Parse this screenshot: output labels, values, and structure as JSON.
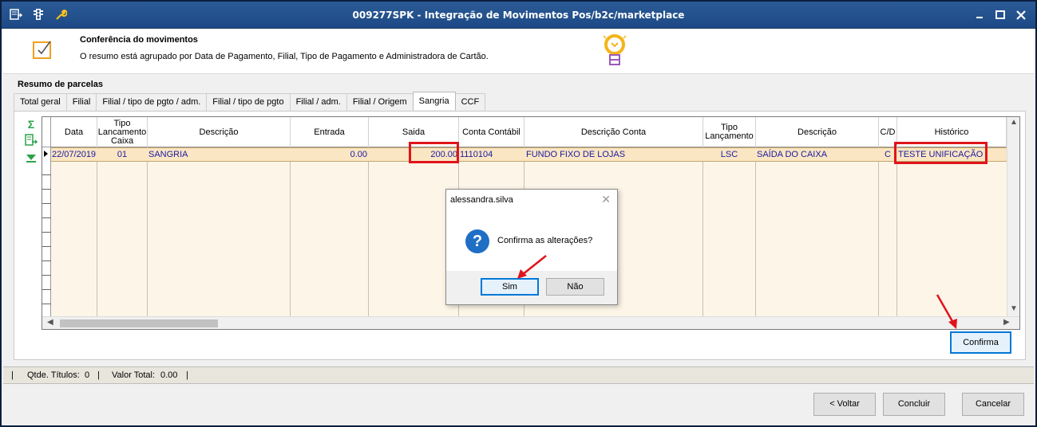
{
  "window": {
    "title": "009277SPK - Integração de Movimentos Pos/b2c/marketplace",
    "min_icon": "minimize-icon",
    "max_icon": "maximize-icon",
    "close_icon": "close-icon"
  },
  "header": {
    "title": "Conferência do movimentos",
    "description": "O resumo está agrupado por Data de Pagamento, Filial, Tipo de Pagamento e Administradora de Cartão."
  },
  "section": {
    "label": "Resumo de parcelas"
  },
  "tabs": [
    {
      "label": "Total geral"
    },
    {
      "label": "Filial"
    },
    {
      "label": "Filial / tipo de pgto / adm."
    },
    {
      "label": "Filial / tipo de pgto"
    },
    {
      "label": "Filial / adm."
    },
    {
      "label": "Filial / Origem"
    },
    {
      "label": "Sangria",
      "active": true
    },
    {
      "label": "CCF"
    }
  ],
  "grid": {
    "columns": [
      "Data",
      "Tipo Lancamento Caixa",
      "Descrição",
      "Entrada",
      "Saida",
      "Conta Contábil",
      "Descrição Conta",
      "Tipo Lançamento",
      "Descrição",
      "C/D",
      "Histórico"
    ],
    "rows": [
      {
        "data": "22/07/2019",
        "tipo_lanc_caixa": "01",
        "descricao": "SANGRIA",
        "entrada": "0.00",
        "saida": "200.00",
        "conta_contabil": "1110104",
        "descricao_conta": "FUNDO FIXO DE LOJAS",
        "tipo_lancamento": "LSC",
        "descricao2": "SAÍDA DO CAIXA",
        "cd": "C",
        "historico": "TESTE UNIFICAÇÃO"
      }
    ]
  },
  "dialog": {
    "title": "alessandra.silva",
    "message": "Confirma as alterações?",
    "yes_label": "Sim",
    "no_label": "Não"
  },
  "buttons": {
    "confirma": "Confirma",
    "voltar": "< Voltar",
    "concluir": "Concluir",
    "cancelar": "Cancelar"
  },
  "status": {
    "qtde_label": "Qtde. Títulos:",
    "qtde_value": "0",
    "valor_label": "Valor Total:",
    "valor_value": "0.00"
  },
  "colors": {
    "titlebar": "#1d4a86",
    "row_highlight": "#fbe6c3",
    "row_text": "#1a1aa0",
    "annotation_red": "#e0141b",
    "primary_button_border": "#0078d7"
  }
}
